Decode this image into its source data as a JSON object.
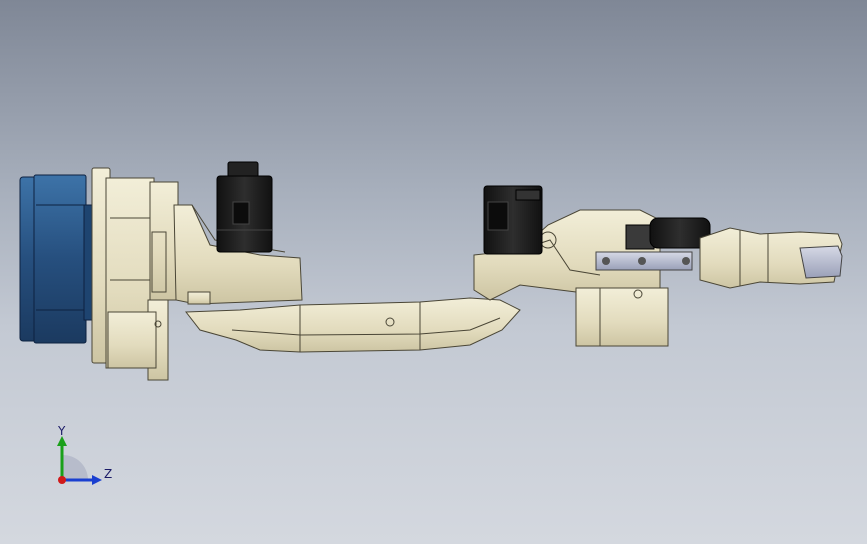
{
  "viewport": {
    "background_top": "#7f8796",
    "background_bottom": "#d4d8df"
  },
  "model": {
    "parts": [
      {
        "name": "base-motor",
        "color": "#2b5a8c"
      },
      {
        "name": "body-casting",
        "color": "#e8e2c6"
      },
      {
        "name": "servo-motor",
        "color": "#1c1c1c"
      }
    ]
  },
  "triad": {
    "y_label": "Y",
    "z_label": "Z",
    "y_color": "#1aa01a",
    "z_color": "#1a3fd0",
    "x_color": "#d01a1a"
  }
}
